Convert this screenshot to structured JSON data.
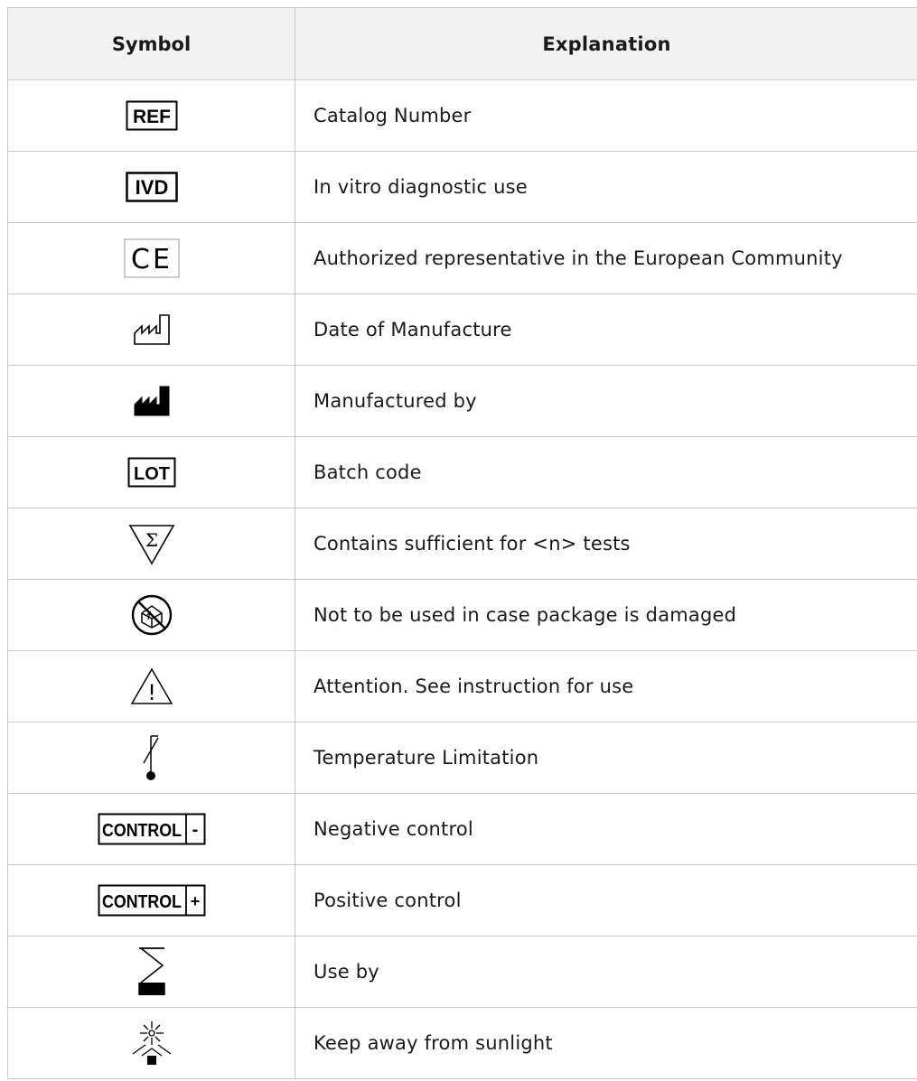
{
  "header": {
    "symbol": "Symbol",
    "explanation": "Explanation"
  },
  "rows": [
    {
      "icon": "ref-icon",
      "symbol_text": "REF",
      "explanation": "Catalog Number"
    },
    {
      "icon": "ivd-icon",
      "symbol_text": "IVD",
      "explanation": "In vitro diagnostic use"
    },
    {
      "icon": "ce-mark-icon",
      "symbol_text": "CE",
      "explanation": "Authorized representative in the European Community"
    },
    {
      "icon": "date-of-manufacture-icon",
      "explanation": "Date of Manufacture"
    },
    {
      "icon": "manufacturer-icon",
      "explanation": "Manufactured by"
    },
    {
      "icon": "lot-icon",
      "symbol_text": "LOT",
      "explanation": "Batch code"
    },
    {
      "icon": "sigma-triangle-icon",
      "symbol_text": "Σ",
      "explanation": "Contains sufficient for <n> tests"
    },
    {
      "icon": "do-not-use-damaged-package-icon",
      "explanation": "Not to be used in case package is damaged"
    },
    {
      "icon": "caution-triangle-icon",
      "symbol_text": "!",
      "explanation": "Attention. See instruction for use"
    },
    {
      "icon": "thermometer-icon",
      "explanation": "Temperature Limitation"
    },
    {
      "icon": "control-negative-icon",
      "symbol_text": "CONTROL",
      "symbol_sign": "-",
      "explanation": "Negative control"
    },
    {
      "icon": "control-positive-icon",
      "symbol_text": "CONTROL",
      "symbol_sign": "+",
      "explanation": "Positive control"
    },
    {
      "icon": "hourglass-icon",
      "explanation": "Use by"
    },
    {
      "icon": "keep-away-sunlight-icon",
      "explanation": "Keep away from sunlight"
    }
  ]
}
